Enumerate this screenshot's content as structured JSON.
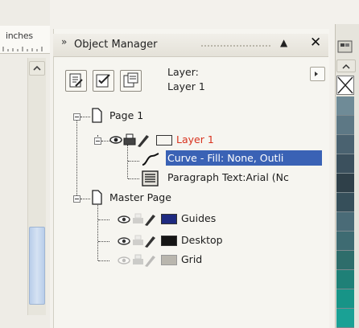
{
  "ruler": {
    "unit_label": "inches"
  },
  "panel": {
    "title": "Object Manager",
    "grip_glyph": "»",
    "pin_glyph": "▲",
    "close_glyph": "✕"
  },
  "toolbar": {
    "buttons": [
      {
        "name": "show-properties-icon"
      },
      {
        "name": "edit-across-layers-icon"
      },
      {
        "name": "layer-manager-view-icon"
      }
    ],
    "layer_label": "Layer:",
    "layer_value": "Layer 1"
  },
  "tree": {
    "page1": {
      "label": "Page 1"
    },
    "layer1": {
      "label": "Layer 1",
      "color": "#d9331f",
      "swatch": "#141414"
    },
    "curve": {
      "label": "Curve - Fill: None, Outli"
    },
    "paragraph": {
      "label": "Paragraph Text:Arial (Nc"
    },
    "master": {
      "label": "Master Page"
    },
    "guides": {
      "label": "Guides",
      "swatch": "#1e2a80"
    },
    "desktop": {
      "label": "Desktop",
      "swatch": "#151515"
    },
    "grid": {
      "label": "Grid",
      "swatch": "#b9b6ae"
    }
  },
  "colors": {
    "selection": "#3a62b5",
    "palette": [
      "#6f8b97",
      "#5d7885",
      "#4a6270",
      "#3b505d",
      "#2f4049",
      "#364f5a",
      "#4a6b77",
      "#3e6b72",
      "#2e6d6b",
      "#1f8077",
      "#179487",
      "#1aa195"
    ]
  }
}
